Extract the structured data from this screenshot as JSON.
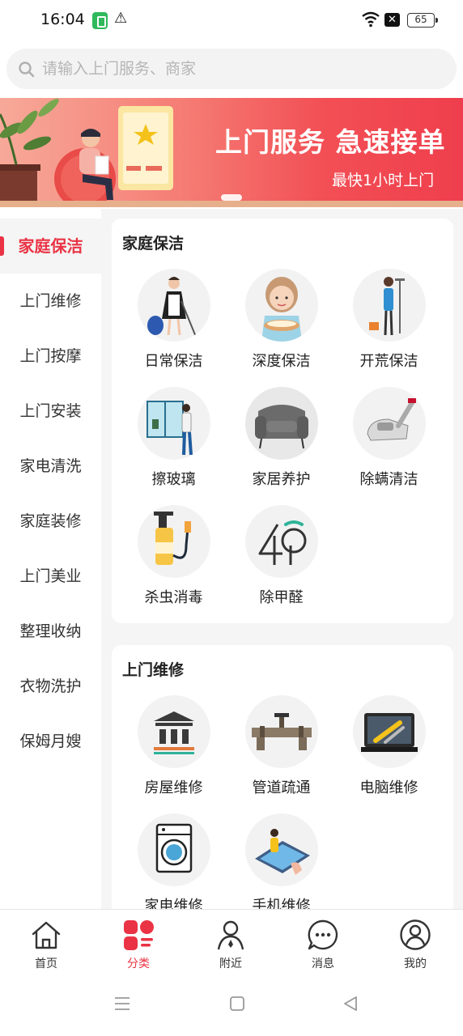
{
  "status_bar": {
    "time": "16:04",
    "battery": "65"
  },
  "search": {
    "placeholder": "请输入上门服务、商家"
  },
  "banner": {
    "title": "上门服务 急速接单",
    "subtitle": "最快1小时上门"
  },
  "sidebar": {
    "items": [
      {
        "label": "家庭保洁",
        "active": true
      },
      {
        "label": "上门维修"
      },
      {
        "label": "上门按摩"
      },
      {
        "label": "上门安装"
      },
      {
        "label": "家电清洗"
      },
      {
        "label": "家庭装修"
      },
      {
        "label": "上门美业"
      },
      {
        "label": "整理收纳"
      },
      {
        "label": "衣物洗护"
      },
      {
        "label": "保姆月嫂"
      }
    ]
  },
  "sections": [
    {
      "title": "家庭保洁",
      "items": [
        {
          "label": "日常保洁",
          "icon": "maid-icon"
        },
        {
          "label": "深度保洁",
          "icon": "washing-basin-icon"
        },
        {
          "label": "开荒保洁",
          "icon": "cleaner-mop-icon"
        },
        {
          "label": "擦玻璃",
          "icon": "window-wipe-icon"
        },
        {
          "label": "家居养护",
          "icon": "armchair-icon"
        },
        {
          "label": "除螨清洁",
          "icon": "mite-vacuum-icon"
        },
        {
          "label": "杀虫消毒",
          "icon": "sprayer-icon"
        },
        {
          "label": "除甲醛",
          "icon": "tree-leaf-icon"
        }
      ]
    },
    {
      "title": "上门维修",
      "items": [
        {
          "label": "房屋维修",
          "icon": "building-icon"
        },
        {
          "label": "管道疏通",
          "icon": "pipe-icon"
        },
        {
          "label": "电脑维修",
          "icon": "computer-repair-icon"
        },
        {
          "label": "家电维修",
          "icon": "washing-machine-icon"
        },
        {
          "label": "手机维修",
          "icon": "phone-repair-icon"
        }
      ]
    }
  ],
  "bottom_nav": [
    {
      "label": "首页",
      "icon": "home-icon"
    },
    {
      "label": "分类",
      "icon": "category-icon",
      "active": true
    },
    {
      "label": "附近",
      "icon": "nearby-person-icon"
    },
    {
      "label": "消息",
      "icon": "message-icon"
    },
    {
      "label": "我的",
      "icon": "profile-icon"
    }
  ],
  "colors": {
    "accent": "#ea3344",
    "banner_end": "#ef3e4d",
    "background": "#f5f5f5"
  }
}
